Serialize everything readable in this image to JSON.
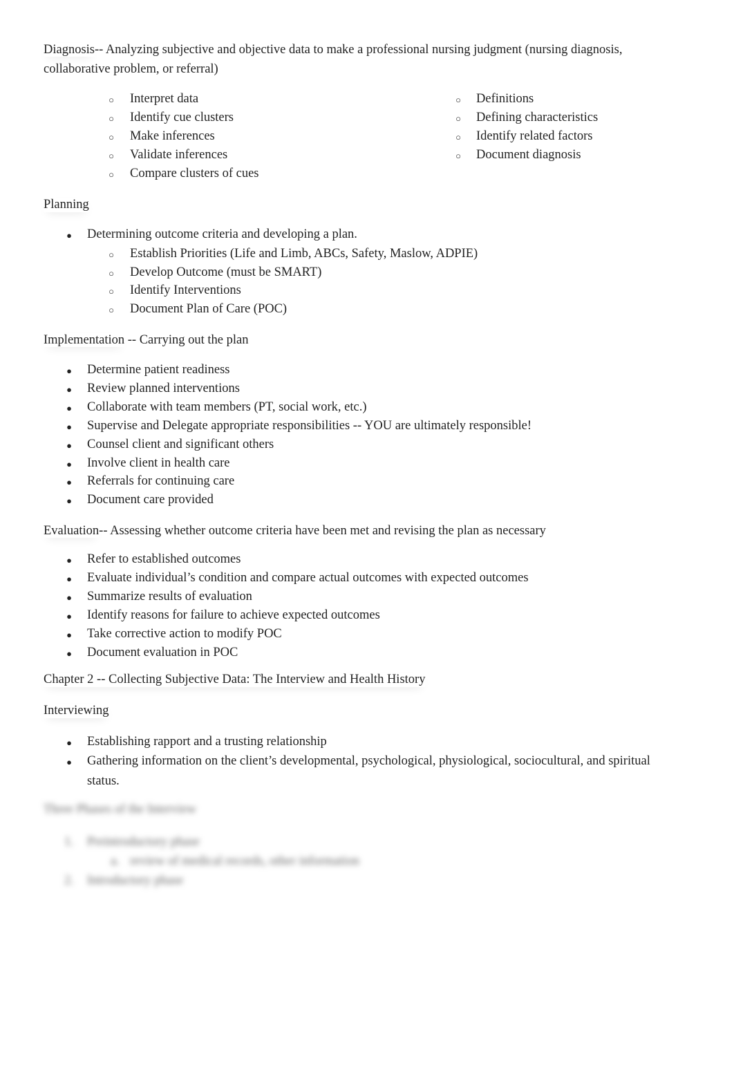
{
  "diagnosis": {
    "title": "Diagnosis",
    "desc_line1": "-- Analyzing subjective and objective data to make a professional nursing judgment (nursing diagnosis,",
    "desc_line2": "collaborative problem, or referral)",
    "left_items": [
      "Interpret data",
      "Identify cue clusters",
      "Make inferences",
      "Validate inferences",
      "Compare clusters of cues"
    ],
    "right_items": [
      "Definitions",
      "Defining characteristics",
      "Identify related factors",
      "Document diagnosis"
    ]
  },
  "planning": {
    "title": "Planning",
    "main_item": "Determining outcome criteria and developing a plan.",
    "sub_items": [
      "Establish Priorities (Life and Limb, ABCs, Safety, Maslow, ADPIE)",
      "Develop Outcome (must be SMART)",
      "Identify Interventions",
      "Document Plan of Care (POC)"
    ]
  },
  "implementation": {
    "title": "Implementation",
    "desc": " -- Carrying out the plan",
    "items": [
      "Determine patient readiness",
      "Review planned interventions",
      "Collaborate with team members (PT, social work, etc.)",
      "Supervise and Delegate appropriate responsibilities -- YOU are ultimately responsible!",
      "Counsel client and significant others",
      "Involve client in health care",
      "Referrals for continuing care",
      "Document care provided"
    ]
  },
  "evaluation": {
    "title": "Evaluation",
    "desc": "-- Assessing whether outcome criteria have been met and revising the plan as necessary",
    "items": [
      "Refer to established outcomes",
      "Evaluate individual’s condition and compare actual outcomes with expected outcomes",
      "Summarize results of evaluation",
      "Identify reasons for failure to achieve expected outcomes",
      "Take corrective action to modify POC",
      "Document evaluation in POC"
    ]
  },
  "chapter2": {
    "title": "Chapter 2 -- Collecting Subjective Data: The Interview and Health History"
  },
  "interviewing": {
    "title": "Interviewing",
    "items": [
      "Establishing rapport and a trusting relationship",
      "Gathering information on the client’s developmental, psychological, physiological, sociocultural, and spiritual"
    ],
    "item2_cont": "status."
  },
  "blurred": {
    "title": "Three Phases of the Interview",
    "item1": "Preintroductory phase",
    "sub1": "review of medical records, other information",
    "item2": "Introductory phase"
  }
}
